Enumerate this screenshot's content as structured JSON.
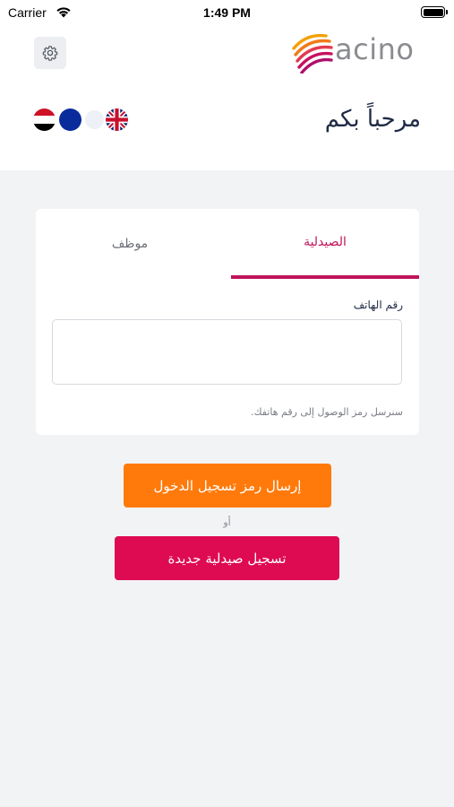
{
  "status_bar": {
    "carrier": "Carrier",
    "time": "1:49 PM",
    "battery_level": 1.0
  },
  "header": {
    "settings_icon": "gear-icon",
    "logo_text": "acino",
    "welcome": "مرحباً بكم",
    "languages": [
      {
        "name": "egypt-flag-icon"
      },
      {
        "name": "eu-flag-icon"
      },
      {
        "name": "uk-flag-icon"
      }
    ]
  },
  "login_card": {
    "tabs": [
      {
        "label": "الصيدلية",
        "active": true
      },
      {
        "label": "موظف",
        "active": false
      }
    ],
    "phone_label": "رقم الهاتف",
    "phone_value": "",
    "phone_placeholder": "",
    "hint": "سنرسل رمز الوصول إلى رقم هاتفك."
  },
  "actions": {
    "send_code": "إرسال رمز تسجيل الدخول",
    "or": "أو",
    "register_pharmacy": "تسجيل صيدلية جديدة"
  },
  "colors": {
    "accent_pink": "#c0145a",
    "send_button": "#ff7a0b",
    "register_button": "#de0a52",
    "background": "#f2f3f5"
  }
}
